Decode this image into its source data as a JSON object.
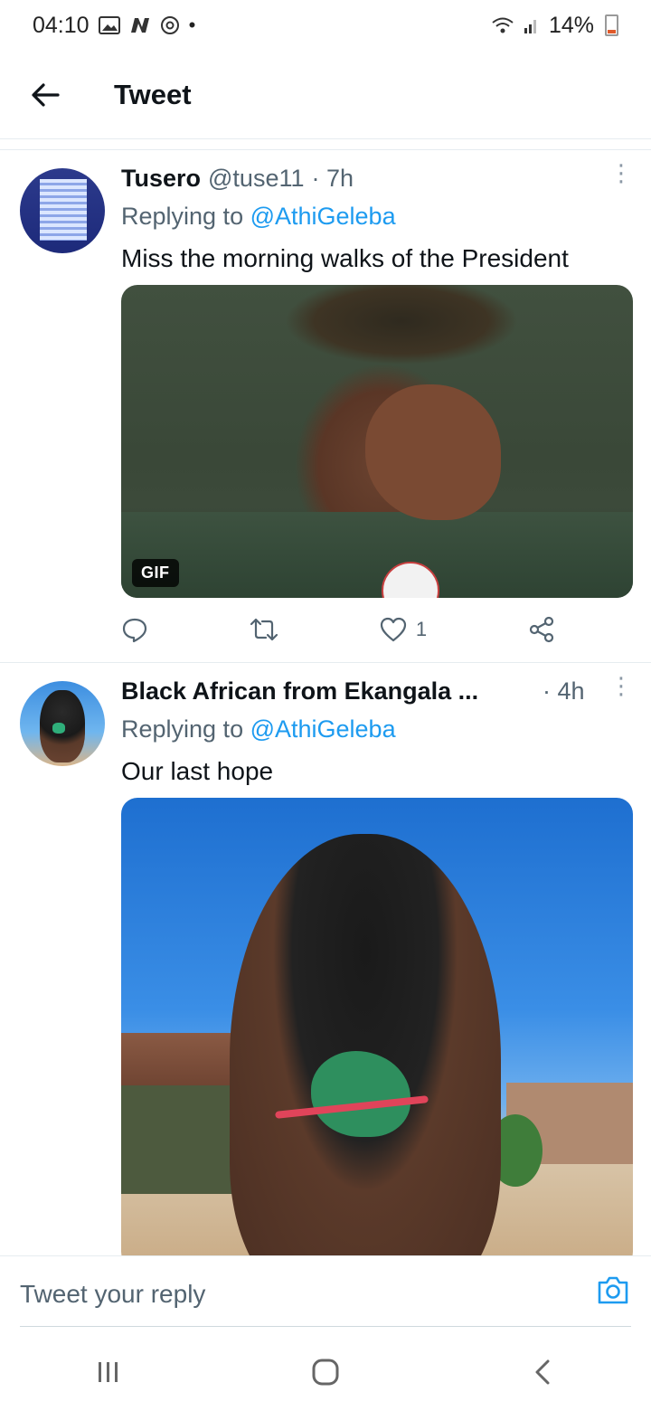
{
  "status_bar": {
    "time": "04:10",
    "battery": "14%",
    "icons": [
      "gallery-icon",
      "n-app-icon",
      "sync-icon",
      "dot-icon",
      "wifi-icon",
      "signal-icon",
      "battery-icon"
    ]
  },
  "header": {
    "title": "Tweet",
    "back_icon": "arrow-left-icon"
  },
  "tweets": [
    {
      "name": "Tusero",
      "handle": "@tuse11",
      "time": "· 7h",
      "replying_prefix": "Replying to ",
      "replying_to": "@AthiGeleba",
      "text": "Miss the morning walks of the President",
      "media_badge": "GIF",
      "likes": "1"
    },
    {
      "name": "Black African from Ekangala ...",
      "handle": "",
      "time": "· 4h",
      "replying_prefix": "Replying to ",
      "replying_to": "@AthiGeleba",
      "text": "Our last hope"
    }
  ],
  "reply_bar": {
    "placeholder": "Tweet your reply",
    "camera_icon": "camera-icon"
  },
  "colors": {
    "accent": "#1d9bf0",
    "secondary_text": "#536471",
    "primary_text": "#0f1419"
  }
}
